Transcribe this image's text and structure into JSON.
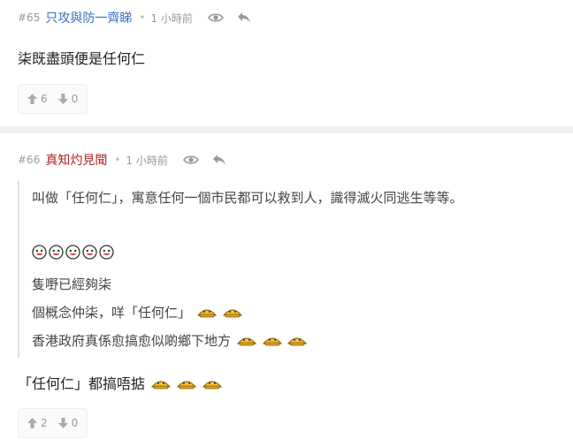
{
  "posts": [
    {
      "floor": "#65",
      "username": "只攻與防一齊睇",
      "time": "1 小時前",
      "icons": [
        "eye-icon",
        "reply-icon"
      ],
      "content": "柒既盡頭便是任何仁",
      "upvotes": "6",
      "downvotes": "0"
    },
    {
      "floor": "#66",
      "username": "真知灼見聞",
      "time": "1 小時前",
      "icons": [
        "eye-icon",
        "reply-icon"
      ],
      "quote": {
        "line1": "叫做「任何仁」，寓意任何一個市民都可以救到人，識得滅火同逃生等等。",
        "line2": "隻嘢已經夠柒",
        "line3": "個概念仲柒，咩「任何仁」",
        "line4": "香港政府真係愈搞愈似啲鄉下地方"
      },
      "content": "「任何仁」都搞唔掂",
      "upvotes": "2",
      "downvotes": "0"
    }
  ],
  "colors": {
    "username_1": "#3471b9",
    "username_2": "#b22222",
    "divider": "#f1f1f1"
  }
}
